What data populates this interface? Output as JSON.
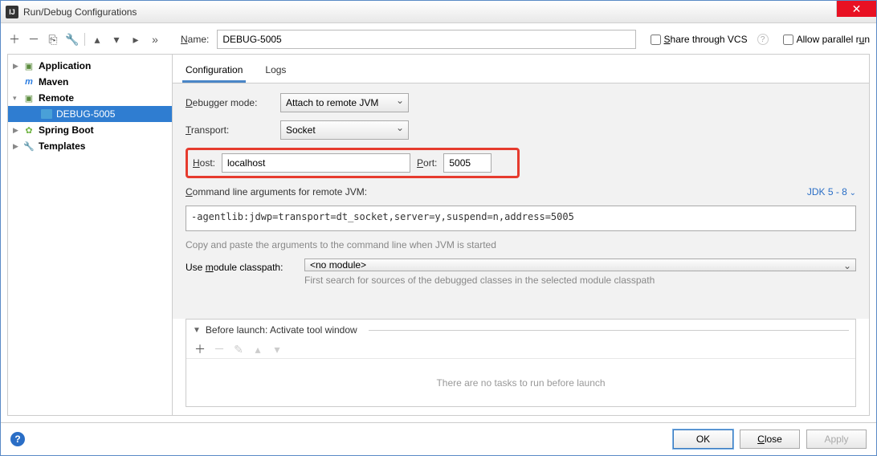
{
  "window": {
    "title": "Run/Debug Configurations"
  },
  "name_field": {
    "label": "Name:",
    "value": "DEBUG-5005"
  },
  "checkboxes": {
    "share": "Share through VCS",
    "parallel": "Allow parallel run"
  },
  "tree": {
    "items": [
      {
        "label": "Application",
        "icon": "app"
      },
      {
        "label": "Maven",
        "icon": "maven"
      },
      {
        "label": "Remote",
        "icon": "remote",
        "expanded": true,
        "children": [
          {
            "label": "DEBUG-5005",
            "icon": "debug",
            "selected": true
          }
        ]
      },
      {
        "label": "Spring Boot",
        "icon": "spring"
      },
      {
        "label": "Templates",
        "icon": "wrench"
      }
    ]
  },
  "tabs": {
    "items": [
      "Configuration",
      "Logs"
    ],
    "active": 0
  },
  "form": {
    "debugger_mode_label": "Debugger mode:",
    "debugger_mode_value": "Attach to remote JVM",
    "transport_label": "Transport:",
    "transport_value": "Socket",
    "host_label": "Host:",
    "host_value": "localhost",
    "port_label": "Port:",
    "port_value": "5005",
    "cmdline_label": "Command line arguments for remote JVM:",
    "jdk_link": "JDK 5 - 8",
    "cmdline_value": "-agentlib:jdwp=transport=dt_socket,server=y,suspend=n,address=5005",
    "cmdline_hint": "Copy and paste the arguments to the command line when JVM is started",
    "module_label": "Use module classpath:",
    "module_value": "<no module>",
    "module_hint": "First search for sources of the debugged classes in the selected module classpath"
  },
  "before_launch": {
    "header": "Before launch: Activate tool window",
    "empty": "There are no tasks to run before launch"
  },
  "buttons": {
    "ok": "OK",
    "cancel": "Close",
    "apply": "Apply"
  }
}
